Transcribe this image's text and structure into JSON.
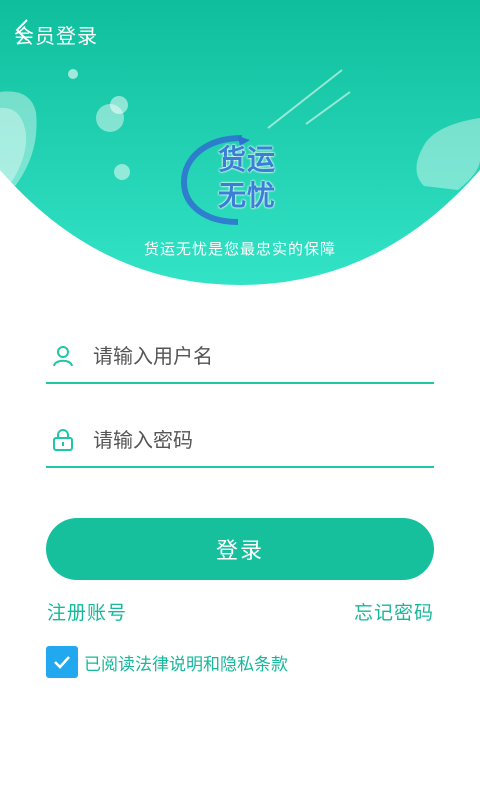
{
  "header": {
    "title": "会员登录",
    "back_icon": "chevron-left-icon"
  },
  "hero": {
    "logo_line1": "货运",
    "logo_line2": "无忧",
    "slogan": "货运无忧是您最忠实的保障",
    "bg_color_top": "#10bf9c",
    "bg_color_bottom": "#2fe0c4"
  },
  "form": {
    "username": {
      "placeholder": "请输入用户名",
      "value": "",
      "icon": "user-icon"
    },
    "password": {
      "placeholder": "请输入密码",
      "value": "",
      "icon": "lock-icon"
    },
    "login_label": "登录",
    "register_label": "注册账号",
    "forgot_label": "忘记密码",
    "agreement_label": "已阅读法律说明和隐私条款",
    "agreement_checked": true
  },
  "colors": {
    "accent": "#17c09d",
    "link": "#16b89a",
    "checkbox": "#22a8ef"
  }
}
